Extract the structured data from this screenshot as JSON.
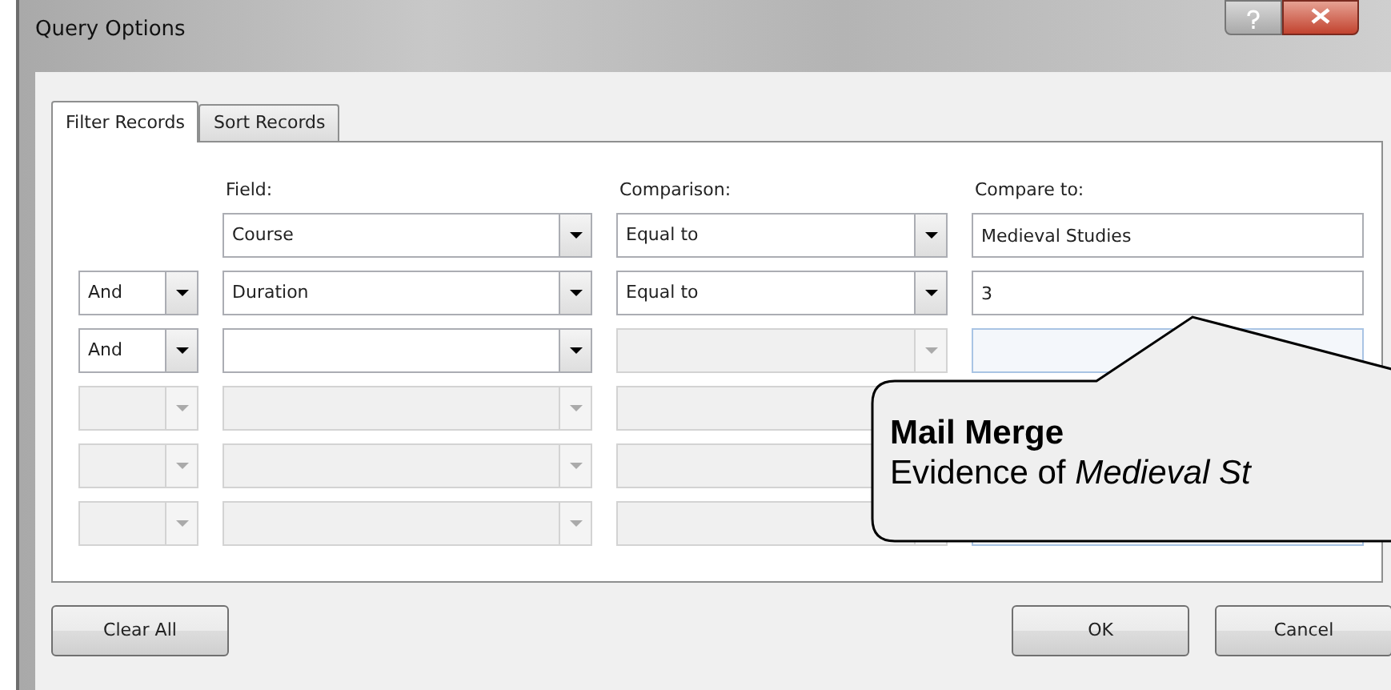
{
  "window": {
    "title": "Query Options"
  },
  "tabs": [
    {
      "label": "Filter Records",
      "selected": true
    },
    {
      "label": "Sort Records",
      "selected": false
    }
  ],
  "columns": [
    "Field:",
    "Comparison:",
    "Compare to:"
  ],
  "rows": [
    {
      "kind": "first",
      "field": "Course",
      "field_disabled": false,
      "comparison": "Equal to",
      "comparison_disabled": false,
      "compare_to": "Medieval Studies",
      "compare_to_disabled": false
    },
    {
      "kind": "clause",
      "conjunction": "And",
      "conjunction_disabled": false,
      "field": "Duration",
      "field_disabled": false,
      "comparison": "Equal to",
      "comparison_disabled": false,
      "compare_to": "3",
      "compare_to_disabled": false
    },
    {
      "kind": "clause",
      "conjunction": "And",
      "conjunction_disabled": false,
      "field_disabled": false,
      "comparison_disabled": true,
      "compare_to_disabled": true
    },
    {
      "kind": "clause",
      "conjunction_disabled": true,
      "field_disabled": true,
      "comparison_disabled": true
    },
    {
      "kind": "clause",
      "conjunction_disabled": true,
      "field_disabled": true,
      "comparison_disabled": true
    },
    {
      "kind": "clause",
      "conjunction_disabled": true,
      "field_disabled": true,
      "comparison_disabled": true,
      "compare_to_disabled": true
    }
  ],
  "buttons": {
    "left": [
      "Clear All"
    ],
    "right": [
      "OK",
      "Cancel"
    ]
  },
  "callout": {
    "title": "Mail Merge",
    "text": "Evidence of *Medieval St*"
  }
}
